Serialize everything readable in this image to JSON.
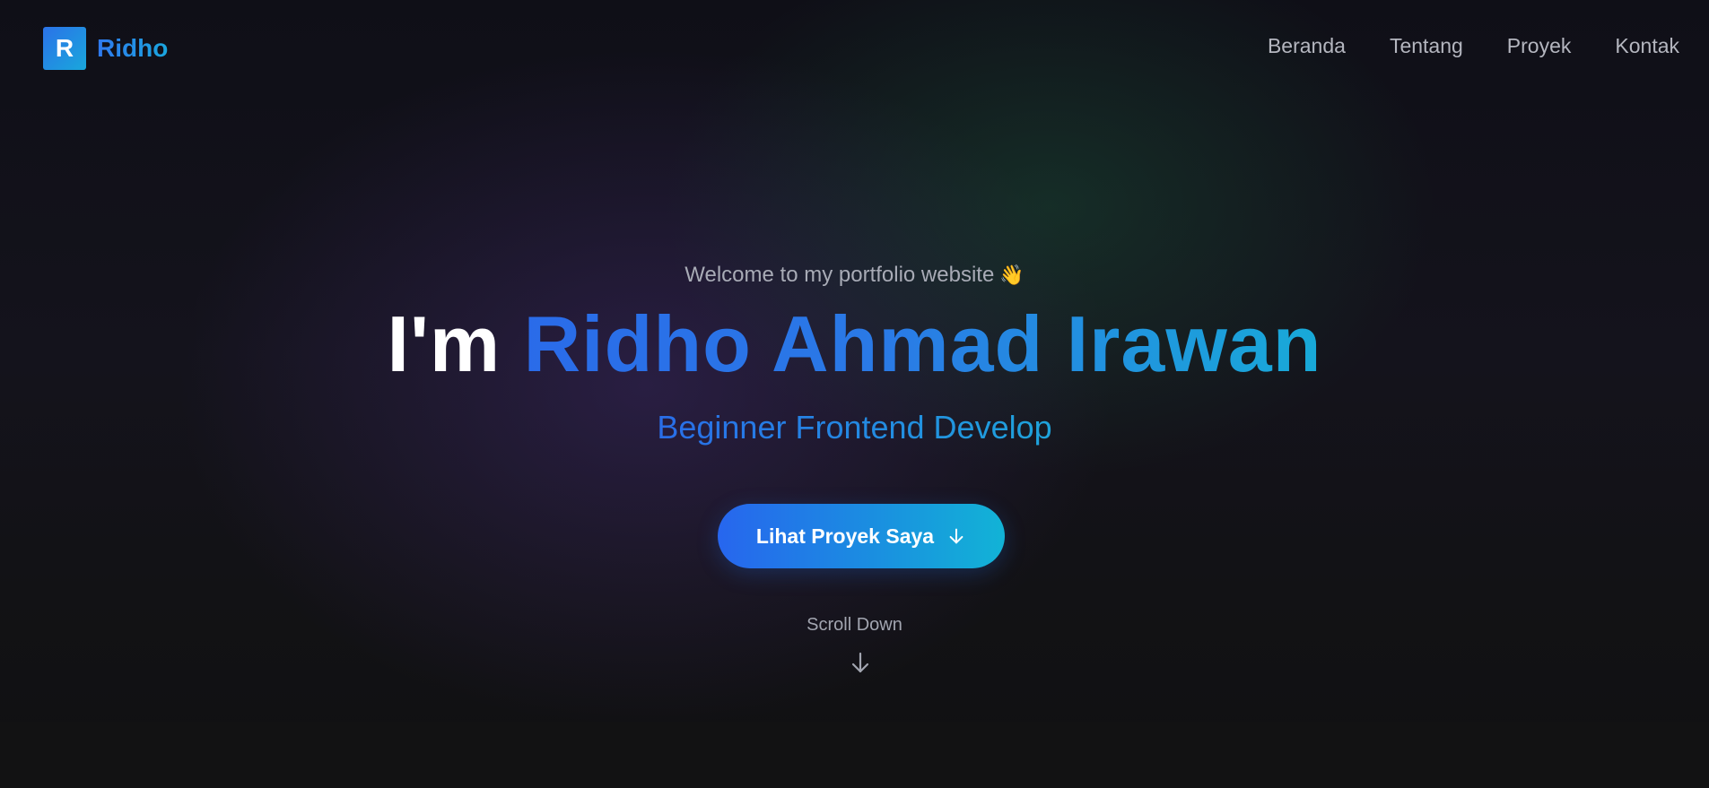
{
  "nav": {
    "logo_letter": "R",
    "logo_text": "Ridho",
    "links": [
      {
        "label": "Beranda"
      },
      {
        "label": "Tentang"
      },
      {
        "label": "Proyek"
      },
      {
        "label": "Kontak"
      }
    ]
  },
  "hero": {
    "greeting": "Welcome to my portfolio website",
    "greeting_emoji": "👋",
    "headline_prefix": "I'm",
    "headline_name": "Ridho Ahmad Irawan",
    "role": "Beginner Frontend Develop",
    "cta_label": "Lihat Proyek Saya",
    "cta_icon": "arrow-down-icon",
    "scroll_label": "Scroll Down",
    "scroll_icon": "arrow-down-icon"
  },
  "colors": {
    "accent_start": "#2766ee",
    "accent_end": "#12b3d6",
    "background": "#111114",
    "nav_text": "#b4b6bf"
  }
}
